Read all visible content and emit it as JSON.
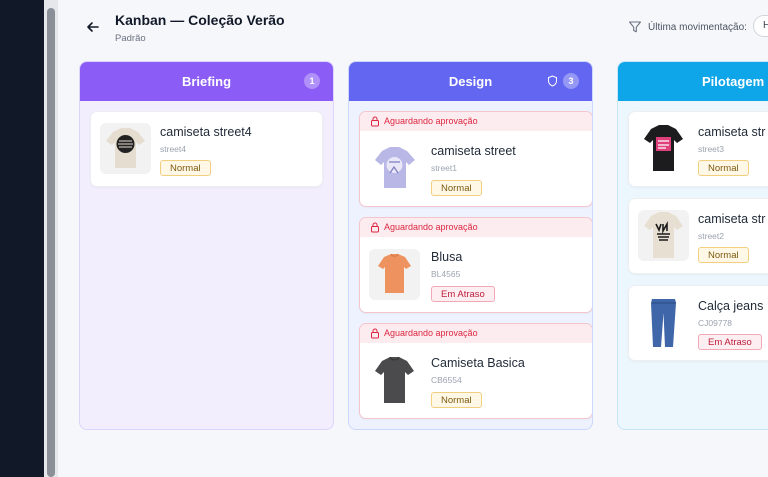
{
  "header": {
    "title": "Kanban — Coleção Verão",
    "subtitle": "Padrão",
    "filter_label": "Última movimentação:",
    "filter_value": "H"
  },
  "columns": [
    {
      "title": "Briefing",
      "count": "1",
      "color": "#8b5cf6",
      "cards": [
        {
          "name": "camiseta street4",
          "code": "street4",
          "status": "Normal",
          "icon": "tshirt-beige-graphic-icon"
        }
      ]
    },
    {
      "title": "Design",
      "count": "3",
      "color": "#6366f1",
      "cards": [
        {
          "lock": "Aguardando aprovação",
          "name": "camiseta street",
          "code": "street1",
          "status": "Normal",
          "icon": "tshirt-lavender-graphic-icon"
        },
        {
          "lock": "Aguardando aprovação",
          "name": "Blusa",
          "code": "BL4565",
          "status": "Em Atraso",
          "icon": "tshirt-orange-icon"
        },
        {
          "lock": "Aguardando aprovação",
          "name": "Camiseta Basica",
          "code": "CB6554",
          "status": "Normal",
          "icon": "tshirt-gray-icon"
        }
      ]
    },
    {
      "title": "Pilotagem",
      "color": "#0ea5e9",
      "cards": [
        {
          "name": "camiseta str",
          "code": "street3",
          "status": "Normal",
          "icon": "tshirt-black-graphic-icon"
        },
        {
          "name": "camiseta str",
          "code": "street2",
          "status": "Normal",
          "icon": "tshirt-newyork-graphic-icon"
        },
        {
          "name": "Calça jeans",
          "code": "CJ09778",
          "status": "Em Atraso",
          "icon": "jeans-icon"
        }
      ]
    }
  ]
}
